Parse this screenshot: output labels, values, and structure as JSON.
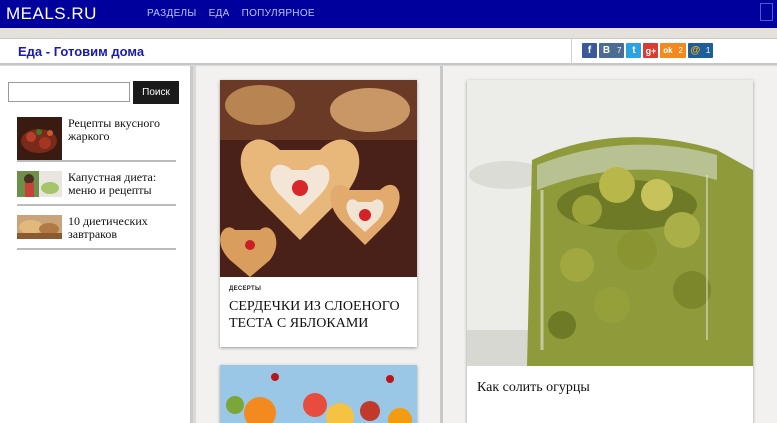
{
  "header": {
    "logo": "MEALS.RU",
    "nav": [
      "Разделы",
      "Еда",
      "Популярное"
    ]
  },
  "titlebar": {
    "title": "Еда - Готовим дома",
    "share": [
      {
        "icon": "facebook-icon",
        "letter": "f",
        "color": "#3b5998",
        "count": ""
      },
      {
        "icon": "vk-icon",
        "letter": "B",
        "color": "#4c6c91",
        "count": "7"
      },
      {
        "icon": "twitter-icon",
        "letter": "t",
        "color": "#2aa3e0",
        "count": ""
      },
      {
        "icon": "google-plus-icon",
        "letter": "g+",
        "color": "#d73d32",
        "count": ""
      },
      {
        "icon": "odnoklassniki-icon",
        "letter": "ok",
        "color": "#f28a1f",
        "count": "2"
      },
      {
        "icon": "mail-ru-icon",
        "letter": "@",
        "color": "#1e5d9c",
        "count": "1"
      }
    ]
  },
  "sidebar": {
    "search_placeholder": "",
    "search_button": "Поиск",
    "items": [
      {
        "title": "Рецепты вкусного жаркого"
      },
      {
        "title": "Капустная диета: меню и рецепты"
      },
      {
        "title": "10 диетических завтраков"
      }
    ]
  },
  "main": {
    "card1": {
      "category": "ДЕСЕРТЫ",
      "title": "Сердечки из слоеного теста с яблоками"
    },
    "card3": {
      "title": "Как солить огурцы"
    }
  }
}
